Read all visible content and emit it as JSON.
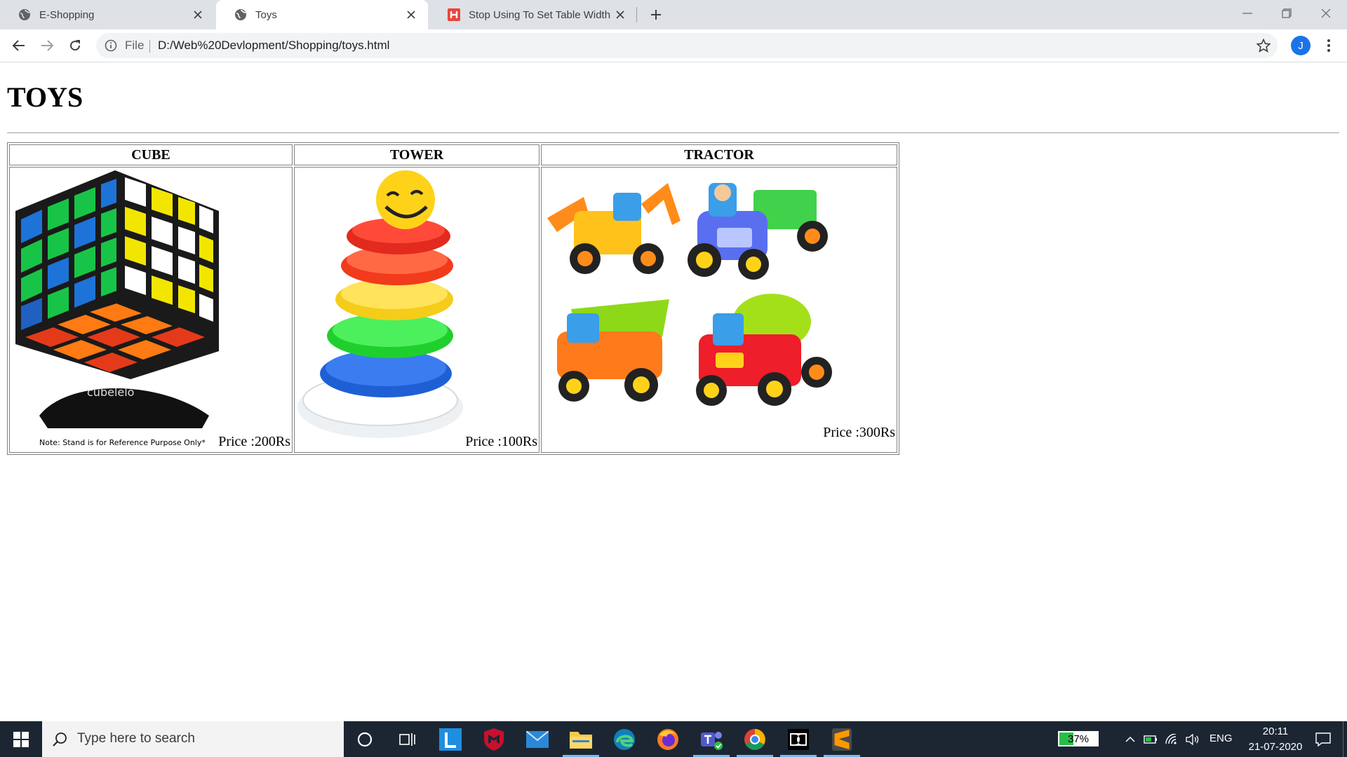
{
  "browser": {
    "tabs": [
      {
        "title": "E-Shopping",
        "favicon": "globe-icon",
        "active": false
      },
      {
        "title": "Toys",
        "favicon": "globe-icon",
        "active": true
      },
      {
        "title": "Stop Using To Set Table Width In",
        "favicon": "h-site-icon",
        "active": false
      }
    ],
    "address": {
      "scheme_label": "File",
      "url": "D:/Web%20Devlopment/Shopping/toys.html"
    },
    "profile_initial": "J"
  },
  "page": {
    "heading": "TOYS",
    "products": [
      {
        "name": "CUBE",
        "price": "Price :200Rs",
        "image": "rubiks-cube-on-stand",
        "caption": "Note: Stand is for Reference Purpose Only*",
        "brand": "cubelelo"
      },
      {
        "name": "TOWER",
        "price": "Price :100Rs",
        "image": "ring-stacking-tower"
      },
      {
        "name": "TRACTOR",
        "price": "Price :300Rs",
        "image": "toy-construction-vehicles"
      }
    ]
  },
  "taskbar": {
    "search_placeholder": "Type here to search",
    "battery_percent": 37,
    "battery_label": "37%",
    "language": "ENG",
    "time": "20:11",
    "date": "21-07-2020"
  },
  "colors": {
    "accent": "#1a73e8",
    "taskbar": "#1c2633",
    "tabstrip": "#dee1e6"
  }
}
